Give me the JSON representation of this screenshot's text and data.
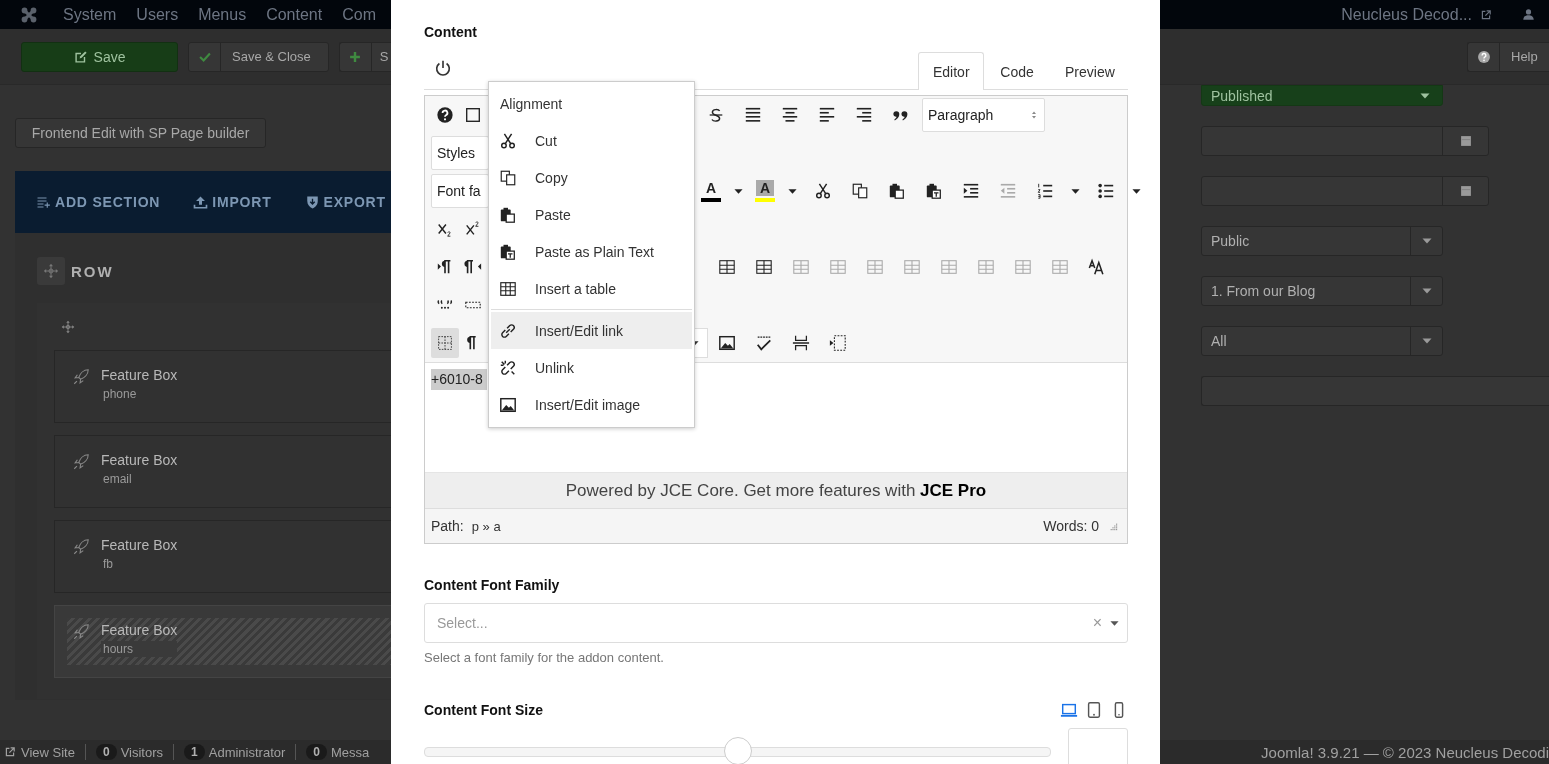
{
  "navbar": {
    "menu": [
      "System",
      "Users",
      "Menus",
      "Content",
      "Com"
    ],
    "site_link": "Neucleus Decod..."
  },
  "toolbar": {
    "buttons": [
      {
        "kind": "primary",
        "label": "Save"
      },
      {
        "kind": "check",
        "label": "Save & Close"
      },
      {
        "kind": "plus",
        "label": "S"
      }
    ],
    "help": "Help"
  },
  "page": {
    "frontend_button": "Frontend Edit with SP Page builder",
    "builder_actions": [
      {
        "kind": "add",
        "label": "ADD SECTION"
      },
      {
        "kind": "import",
        "label": "IMPORT"
      },
      {
        "kind": "export",
        "label": "EXPORT"
      }
    ],
    "row_title": "ROW",
    "addons": [
      {
        "title": "Feature Box",
        "subtitle": "phone",
        "highlighted": false
      },
      {
        "title": "Feature Box",
        "subtitle": "email",
        "highlighted": false
      },
      {
        "title": "Feature Box",
        "subtitle": "fb",
        "highlighted": false
      },
      {
        "title": "Feature Box",
        "subtitle": "hours",
        "highlighted": true
      }
    ]
  },
  "sidebar": {
    "fields": [
      {
        "kind": "status",
        "value": "Published"
      },
      {
        "kind": "date"
      },
      {
        "kind": "date"
      },
      {
        "kind": "select",
        "value": "Public"
      },
      {
        "kind": "select",
        "value": "1. From our Blog"
      },
      {
        "kind": "select",
        "value": "All"
      },
      {
        "kind": "text"
      }
    ]
  },
  "status_bar": {
    "items": [
      {
        "kind": "link",
        "label": "View Site"
      },
      {
        "kind": "counter",
        "count": "0",
        "label": "Visitors"
      },
      {
        "kind": "counter",
        "count": "1",
        "label": "Administrator"
      },
      {
        "kind": "counter",
        "count": "0",
        "label": "Messa"
      }
    ],
    "copyright": "Joomla! 3.9.21 — © 2023 Neucleus Decodi"
  },
  "modal": {
    "content_label": "Content",
    "tabs": [
      {
        "label": "Editor",
        "selected": true
      },
      {
        "label": "Code",
        "selected": false
      },
      {
        "label": "Preview",
        "selected": false
      }
    ],
    "toolbar_rows": [
      {
        "left": [
          {
            "kind": "help"
          },
          {
            "kind": "box"
          }
        ],
        "right": [
          {
            "kind": "strike"
          },
          {
            "kind": "justify"
          },
          {
            "kind": "center"
          },
          {
            "kind": "left"
          },
          {
            "kind": "right"
          },
          {
            "kind": "quote"
          },
          {
            "kind": "spin-select",
            "value": "Paragraph"
          }
        ]
      },
      {
        "left": [
          {
            "kind": "select",
            "value": "Styles"
          }
        ]
      },
      {
        "left": [
          {
            "kind": "select",
            "value": "Font fa"
          }
        ],
        "right": [
          {
            "kind": "color-a",
            "label": "A",
            "color": "#000000",
            "disabled": false
          },
          {
            "kind": "caret",
            "disabled": false
          },
          {
            "kind": "highlight-a",
            "label": "A",
            "color": "#ffff00",
            "disabled": false
          },
          {
            "kind": "caret",
            "disabled": false
          },
          {
            "kind": "cut",
            "disabled": false
          },
          {
            "kind": "copy",
            "disabled": false
          },
          {
            "kind": "paste",
            "disabled": false
          },
          {
            "kind": "pastetext",
            "disabled": false
          },
          {
            "kind": "indent",
            "disabled": false
          },
          {
            "kind": "outdent",
            "disabled": true
          },
          {
            "kind": "ol",
            "disabled": false
          },
          {
            "kind": "caret",
            "disabled": false
          },
          {
            "kind": "ul",
            "disabled": false
          },
          {
            "kind": "caret",
            "disabled": false
          }
        ]
      },
      {
        "left": [
          {
            "kind": "sub"
          },
          {
            "kind": "sup"
          }
        ]
      },
      {
        "left": [
          {
            "kind": "ltr"
          },
          {
            "kind": "rtl"
          }
        ],
        "right": [
          {
            "kind": "tablecell",
            "disabled": false
          },
          {
            "kind": "tablecell",
            "disabled": false
          },
          {
            "kind": "tablecell",
            "disabled": true
          },
          {
            "kind": "tablecell",
            "disabled": true
          },
          {
            "kind": "tablecell",
            "disabled": true
          },
          {
            "kind": "tablecell",
            "disabled": true
          },
          {
            "kind": "tablecell",
            "disabled": true
          },
          {
            "kind": "tablecell",
            "disabled": true
          },
          {
            "kind": "tablecell",
            "disabled": true
          },
          {
            "kind": "tablecell",
            "disabled": true
          },
          {
            "kind": "styleprops",
            "disabled": false
          }
        ]
      },
      {
        "left": [
          {
            "kind": "cite"
          },
          {
            "kind": "abbr"
          }
        ]
      },
      {
        "left": [
          {
            "kind": "visualaid",
            "selected": true
          },
          {
            "kind": "blocks",
            "selected": false
          }
        ],
        "right": [
          {
            "kind": "select-end"
          },
          {
            "kind": "image"
          },
          {
            "kind": "spell"
          },
          {
            "kind": "pagebreak"
          },
          {
            "kind": "readmore"
          }
        ]
      }
    ],
    "body_text": "+6010-8",
    "promo": "Powered by JCE Core. Get more features with **JCE Pro**",
    "path_label": "Path:",
    "path": "p » a",
    "words": "Words: 0",
    "font_family": {
      "label": "Content Font Family",
      "placeholder": "Select...",
      "clear": "×",
      "help": "Select a font family for the addon content."
    },
    "font_size": {
      "label": "Content Font Size",
      "devices": [
        {
          "kind": "desktop",
          "selected": true
        },
        {
          "kind": "tablet",
          "selected": false
        },
        {
          "kind": "mobile",
          "selected": false
        }
      ],
      "slider": {
        "level": 0.5
      }
    }
  },
  "context_menu": {
    "title": "Alignment",
    "items": [
      {
        "kind": "cut",
        "label": "Cut",
        "selected": false,
        "divider_before": false
      },
      {
        "kind": "copy",
        "label": "Copy",
        "selected": false,
        "divider_before": false
      },
      {
        "kind": "paste",
        "label": "Paste",
        "selected": false,
        "divider_before": false
      },
      {
        "kind": "pastetext",
        "label": "Paste as Plain Text",
        "selected": false,
        "divider_before": false
      },
      {
        "kind": "table",
        "label": "Insert a table",
        "selected": false,
        "divider_before": false
      },
      {
        "kind": "link",
        "label": "Insert/Edit link",
        "selected": true,
        "divider_before": true
      },
      {
        "kind": "unlink",
        "label": "Unlink",
        "selected": false,
        "divider_before": false
      },
      {
        "kind": "image",
        "label": "Insert/Edit image",
        "selected": false,
        "divider_before": false
      }
    ]
  }
}
